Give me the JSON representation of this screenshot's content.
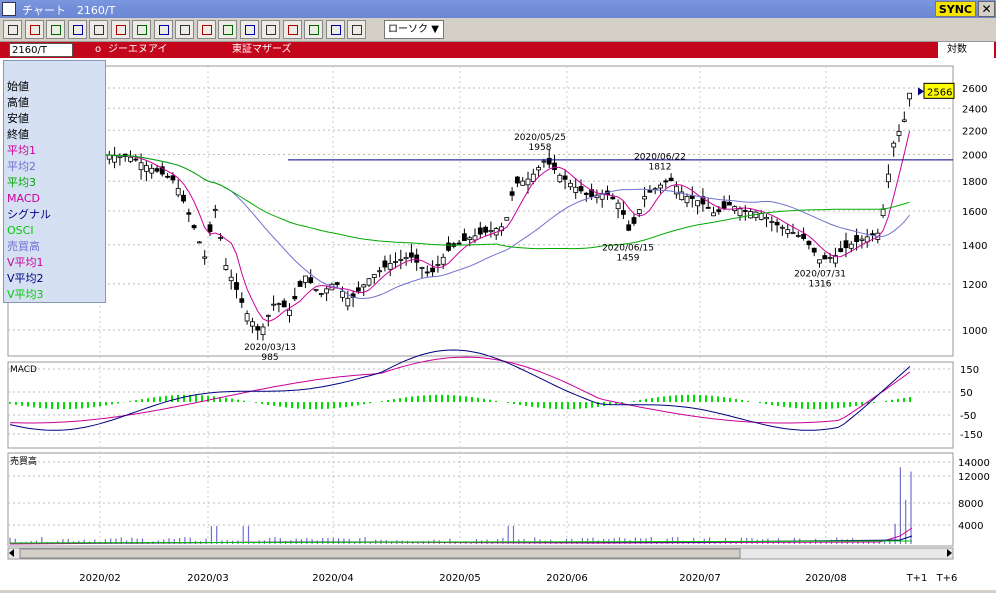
{
  "window": {
    "title": "チャート　2160/T",
    "sync_label": "SYNC",
    "close_label": "✕"
  },
  "toolbar": {
    "icons": [
      "chart-icon",
      "candle-icon",
      "line-chart-icon",
      "bar-chart-icon",
      "list-icon",
      "print-icon",
      "target-icon",
      "ruler-icon",
      "log-icon",
      "compare-icon",
      "window-icon",
      "calculator-icon",
      "grid-icon",
      "pencil-icon",
      "eraser-icon",
      "search-icon",
      "settings-icon"
    ],
    "period_select": "ローソク",
    "period_arrow": "▼"
  },
  "infobar": {
    "code": "2160/T",
    "marker": "o",
    "name": "ジーエヌアイ",
    "market": "東証マザーズ",
    "scale_label": "対数"
  },
  "legend": {
    "items": [
      {
        "label": "始値",
        "color": "#000000"
      },
      {
        "label": "高値",
        "color": "#000000"
      },
      {
        "label": "安値",
        "color": "#000000"
      },
      {
        "label": "終値",
        "color": "#000000"
      },
      {
        "label": "平均1",
        "color": "#cc0099"
      },
      {
        "label": "平均2",
        "color": "#7070d0"
      },
      {
        "label": "平均3",
        "color": "#00aa00"
      },
      {
        "label": "MACD",
        "color": "#cc0099"
      },
      {
        "label": "シグナル",
        "color": "#000080"
      },
      {
        "label": "OSCI",
        "color": "#00cc00"
      },
      {
        "label": "売買高",
        "color": "#7070d0"
      },
      {
        "label": "V平均1",
        "color": "#cc0099"
      },
      {
        "label": "V平均2",
        "color": "#000080"
      },
      {
        "label": "V平均3",
        "color": "#00cc00"
      }
    ]
  },
  "chart_data": {
    "type": "candlestick",
    "price_axis": {
      "ticks": [
        1000,
        1200,
        1400,
        1600,
        1800,
        2000,
        2200,
        2400,
        2600
      ],
      "scale": "log"
    },
    "macd_axis": {
      "title": "MACD",
      "ticks": [
        "150",
        "50",
        "-50",
        "-150"
      ]
    },
    "volume_axis": {
      "title": "売買高",
      "ticks": [
        "14000",
        "12000",
        "8000",
        "4000"
      ]
    },
    "x_labels": [
      "2020/02",
      "2020/03",
      "2020/04",
      "2020/05",
      "2020/06",
      "2020/07",
      "2020/08",
      "T+1",
      "T+6"
    ],
    "current_price": "2566",
    "horizontal_line": 1958,
    "annotations": [
      {
        "date": "2020/03/13",
        "price": "985",
        "kind": "low"
      },
      {
        "date": "2020/05/25",
        "price": "1958",
        "kind": "high"
      },
      {
        "date": "2020/06/15",
        "price": "1459",
        "kind": "low"
      },
      {
        "date": "2020/06/22",
        "price": "1812",
        "kind": "high"
      },
      {
        "date": "2020/07/31",
        "price": "1316",
        "kind": "low"
      }
    ]
  }
}
